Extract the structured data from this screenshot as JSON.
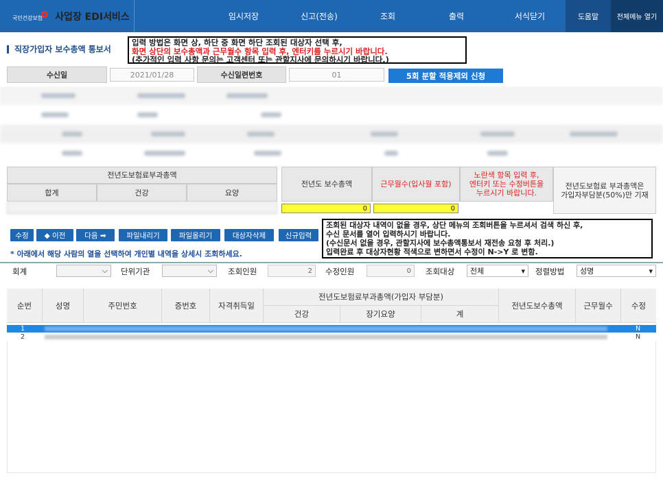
{
  "app": {
    "org": "국민건강보험",
    "title": "사업장 EDI서비스"
  },
  "menu": [
    "임시저장",
    "신고(전송)",
    "조회",
    "출력",
    "서식닫기"
  ],
  "help": "도움말",
  "full_menu": "전체메뉴 열기",
  "page_title": "직장가입자 보수총액 통보서",
  "notice1": [
    "입력 방법은 화면 상, 하단 중 화면 하단 조회된 대상자 선택 후,",
    "화면 상단의 보수총액과 근무월수 항목 입력 후, 엔터키를 누르시기 바랍니다.",
    "(추가적인 입력 사항 문의는 고객센터 또는 관할지사에 문의하시기 바랍니다.)"
  ],
  "receipt": {
    "date_label": "수신일",
    "date": "2021/01/28",
    "seq_label": "수신일련번호",
    "seq": "01",
    "apply_btn": "5회 분할 적용제외 신청"
  },
  "calc": {
    "prev_total_label": "전년도보험료부과총액",
    "sum": "합계",
    "health": "건강",
    "care": "요양",
    "prev_pay_label": "전년도 보수총액",
    "months_label": "근무월수(입사월 포함)",
    "prev_pay": "0",
    "months": "0",
    "yellow_note": [
      "노란색 항목 입력 후,",
      "엔터키 또는 수정버튼을",
      "누르시기 바랍니다."
    ],
    "right_note": [
      "전년도보험료 부과총액은",
      "가입자부담분(50%)만 기재"
    ]
  },
  "buttons": [
    "수정",
    "◆ 이전",
    "다음 ➡",
    "파일내리기",
    "파일올리기",
    "대상자삭제",
    "신규입력"
  ],
  "notice2": [
    "조회된 대상자 내역이 없을 경우, 상단 메뉴의 조회버튼을 누르셔서 검색 하신 후,",
    "수신 문서를 열어 입력하시기 바랍니다.",
    "(수신문서 없을 경우, 관할지사에 보수총액통보서 재전송 요청 후 처리.)",
    "입력완료 후 대상자현황 적색으로 변하면서 수정이 N->Y 로 변함."
  ],
  "tip": "* 아래에서 해당 사람의 열을 선택하여 개인별 내역을 상세시 조회하세요.",
  "filters": {
    "account": "회계",
    "unit": "단위기관",
    "query_count_label": "조회인원",
    "query_count": "2",
    "modified_label": "수정인원",
    "modified": "0",
    "target_label": "조회대상",
    "target": "전체",
    "sort_label": "정렬방법",
    "sort": "성명"
  },
  "grid": {
    "headers": {
      "no": "순번",
      "name": "성명",
      "rrn": "주민번호",
      "card": "증번호",
      "acq": "자격취득일",
      "prev_group": "전년도보험료부과총액(가입자 부담분)",
      "health": "건강",
      "ltc": "장기요양",
      "total": "계",
      "prev_pay": "전년도보수총액",
      "months": "근무월수",
      "edit": "수정"
    },
    "rows": [
      {
        "no": "1",
        "edit": "N"
      },
      {
        "no": "2",
        "edit": "N"
      }
    ]
  },
  "colors": {
    "primary": "#1f66b3",
    "highlight": "#1e88e5",
    "yellow": "#ffff33",
    "red": "#e02020"
  }
}
